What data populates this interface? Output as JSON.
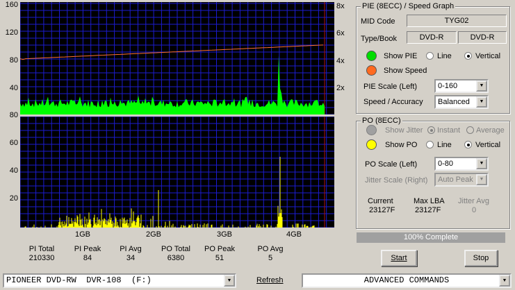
{
  "pie_graph": {
    "y_left_ticks": [
      "160",
      "120",
      "80",
      "40"
    ],
    "y_right_ticks": [
      "8x",
      "6x",
      "4x",
      "2x"
    ],
    "pie_max": 160,
    "speed_max": 8
  },
  "po_graph": {
    "y_left_ticks": [
      "80",
      "60",
      "40",
      "20"
    ],
    "po_max": 80
  },
  "x_ticks": [
    "1GB",
    "2GB",
    "3GB",
    "4GB"
  ],
  "colors": {
    "graph_bg": "#000000",
    "grid": "#1c1cd0",
    "pie": "#00ff00",
    "po": "#ffff00",
    "speed": "#ff7030",
    "end_marker": "#b01010",
    "show_pie_dot": "#00dd00",
    "show_speed_dot": "#ff6a20",
    "show_po_dot": "#ffff00",
    "show_jitter_dot": "#a0a0a0"
  },
  "stats": [
    {
      "label": "PI Total",
      "value": "210330"
    },
    {
      "label": "PI Peak",
      "value": "84"
    },
    {
      "label": "PI Avg",
      "value": "34"
    },
    {
      "label": "PO Total",
      "value": "6380"
    },
    {
      "label": "PO Peak",
      "value": "51"
    },
    {
      "label": "PO Avg",
      "value": "5"
    }
  ],
  "pie_panel": {
    "title": "PIE (8ECC) / Speed Graph",
    "mid_code_label": "MID Code",
    "mid_code_value": "TYG02",
    "type_book_label": "Type/Book",
    "type_value": "DVD-R",
    "book_value": "DVD-R",
    "show_pie_label": "Show PIE",
    "line_label": "Line",
    "vertical_label": "Vertical",
    "show_speed_label": "Show Speed",
    "pie_scale_label": "PIE Scale (Left)",
    "pie_scale_value": "0-160",
    "speed_accuracy_label": "Speed / Accuracy",
    "speed_accuracy_value": "Balanced"
  },
  "po_panel": {
    "title": "PO (8ECC)",
    "show_jitter_label": "Show Jitter",
    "instant_label": "Instant",
    "average_label": "Average",
    "show_po_label": "Show PO",
    "line_label": "Line",
    "vertical_label": "Vertical",
    "po_scale_label": "PO Scale (Left)",
    "po_scale_value": "0-80",
    "jitter_scale_label": "Jitter Scale (Right)",
    "jitter_scale_value": "Auto Peak",
    "current_label": "Current",
    "current_value": "23127F",
    "max_lba_label": "Max LBA",
    "max_lba_value": "23127F",
    "jitter_avg_label": "Jitter Avg",
    "jitter_avg_value": "0"
  },
  "progress": {
    "text": "100% Complete",
    "fraction": 1.0
  },
  "buttons": {
    "start": "Start",
    "stop": "Stop",
    "refresh": "Refresh"
  },
  "drive_select": "PIONEER DVD-RW  DVR-108  (F:)",
  "commands_select": "ADVANCED COMMANDS"
}
